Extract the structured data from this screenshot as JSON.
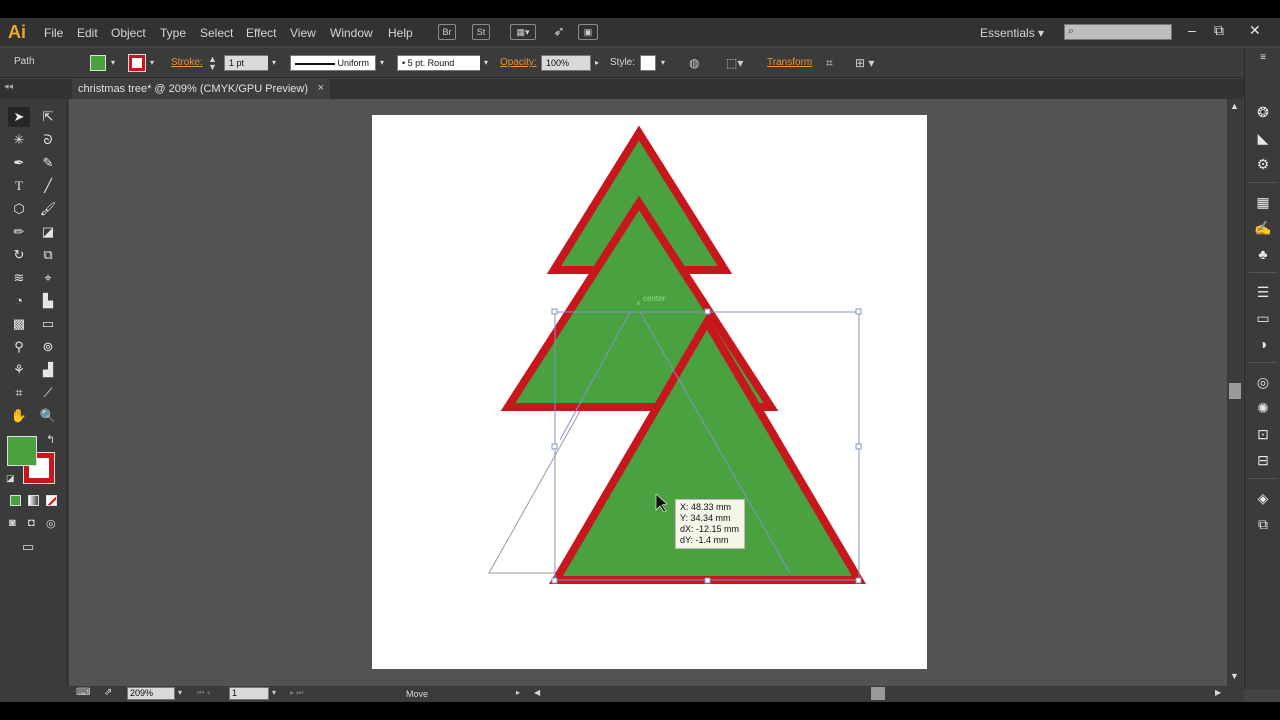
{
  "app": {
    "logo": "Ai"
  },
  "menu": [
    "File",
    "Edit",
    "Object",
    "Type",
    "Select",
    "Effect",
    "View",
    "Window",
    "Help"
  ],
  "menubar_icons": {
    "br": "Br",
    "st": "St"
  },
  "workspace": {
    "label": "Essentials"
  },
  "control_bar": {
    "selection_type": "Path",
    "stroke_label": "Stroke:",
    "stroke_weight": "1 pt",
    "profile": "Uniform",
    "brush": "5 pt. Round",
    "opacity_label": "Opacity:",
    "opacity_value": "100%",
    "style_label": "Style:",
    "transform_label": "Transform",
    "fill_color": "#4aa13f",
    "stroke_color": "#c8161d"
  },
  "document": {
    "tab_title": "christmas tree* @ 209% (CMYK/GPU Preview)"
  },
  "canvas": {
    "smart_guide_label": "center",
    "readout": {
      "x": "X: 48.33 mm",
      "y": "Y: 34.34 mm",
      "dx": "dX: -12.15 mm",
      "dy": "dY: -1.4 mm"
    },
    "tree_fill": "#4aa13f",
    "tree_stroke": "#c8161d"
  },
  "status_bar": {
    "zoom": "209%",
    "page": "1",
    "tool_status": "Move"
  }
}
